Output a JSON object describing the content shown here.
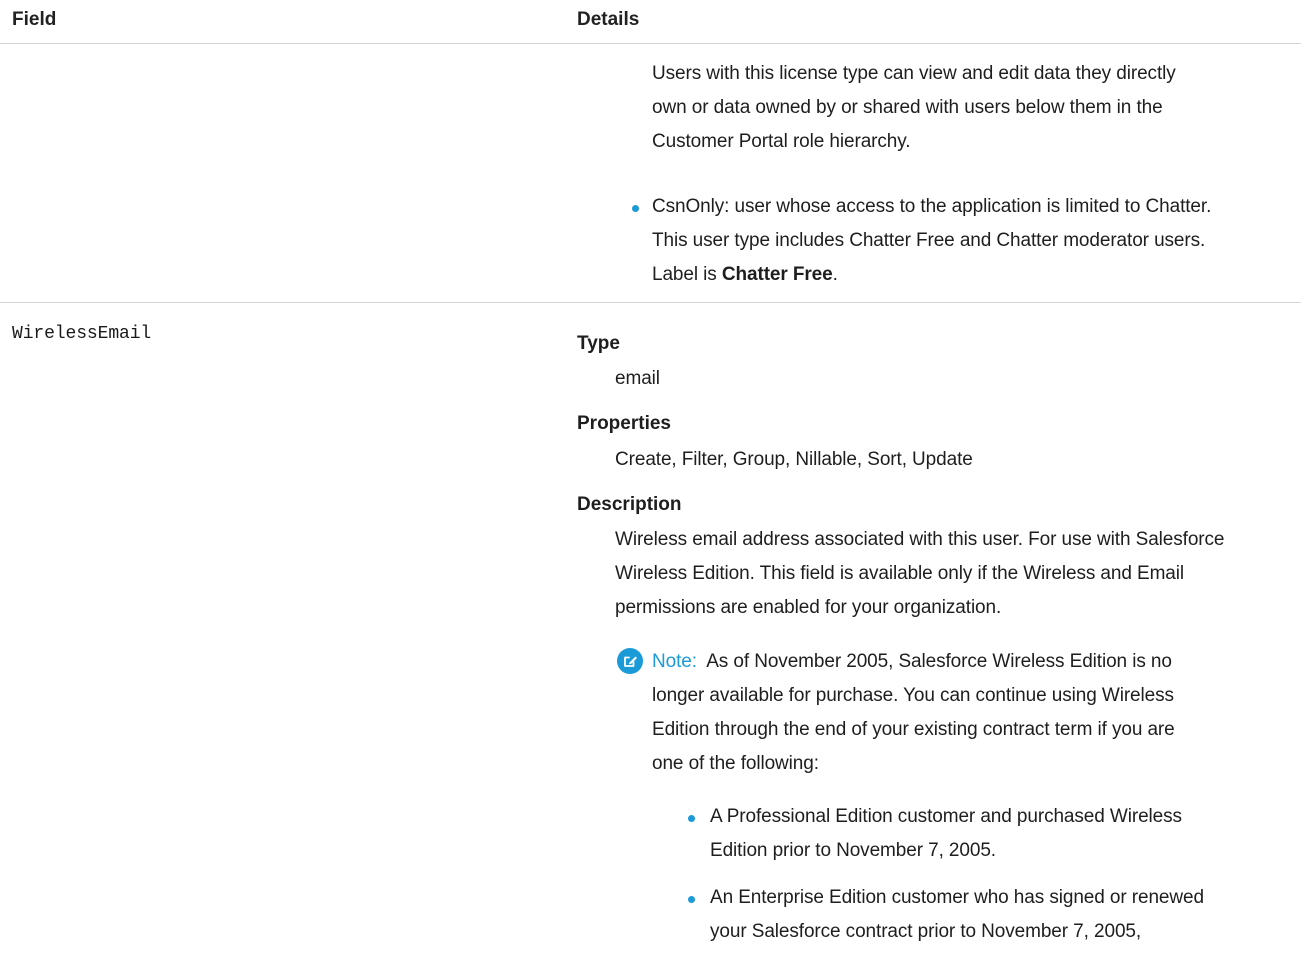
{
  "header": {
    "field_label": "Field",
    "details_label": "Details"
  },
  "row1": {
    "para": [
      "Users with this license type can view and edit data they directly",
      "own or data owned by or shared with users below them in the",
      "Customer Portal role hierarchy."
    ],
    "bullet": [
      "CsnOnly: user whose access to the application is limited to Chatter.",
      "This user type includes Chatter Free and Chatter moderator users."
    ],
    "bullet_last_prefix": "Label is ",
    "bullet_last_bold": "Chatter Free",
    "bullet_last_suffix": "."
  },
  "row2": {
    "field_name": "WirelessEmail",
    "type_label": "Type",
    "type_value": "email",
    "properties_label": "Properties",
    "properties_value": "Create, Filter, Group, Nillable, Sort, Update",
    "description_label": "Description",
    "description_lines": [
      "Wireless email address associated with this user. For use with Salesforce",
      "Wireless Edition. This field is available only if the Wireless and Email",
      "permissions are enabled for your organization."
    ],
    "note_label": "Note:",
    "note_lines": [
      "As of November 2005, Salesforce Wireless Edition is no",
      "longer available for purchase. You can continue using Wireless",
      "Edition through the end of your existing contract term if you are",
      "one of the following:"
    ],
    "note_bullets": [
      [
        "A Professional Edition customer and purchased Wireless",
        "Edition prior to November 7, 2005."
      ],
      [
        "An Enterprise Edition customer who has signed or renewed",
        "your Salesforce contract prior to November 7, 2005,"
      ]
    ]
  },
  "colors": {
    "accent": "#1b9ad8",
    "divider": "#d4d4d4"
  },
  "icons": {
    "note": "note-edit-icon",
    "bullet": "bullet-dot-icon"
  }
}
